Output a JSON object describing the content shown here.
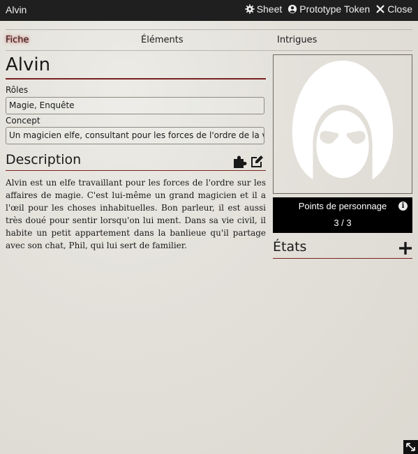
{
  "window": {
    "title": "Alvin",
    "controls": {
      "sheet_label": "Sheet",
      "prototype_label": "Prototype Token",
      "close_label": "Close"
    }
  },
  "tabs": [
    {
      "label": "Fiche",
      "active": true
    },
    {
      "label": "Éléments",
      "active": false
    },
    {
      "label": "Intrigues",
      "active": false
    }
  ],
  "character": {
    "name": "Alvin",
    "roles_label": "Rôles",
    "roles_value": "Magie, Enquête",
    "concept_label": "Concept",
    "concept_value": "Un magicien elfe, consultant pour les forces de l'ordre de la ville"
  },
  "description": {
    "heading": "Description",
    "text": "Alvin est un elfe travaillant pour les forces de l'ordre sur les affaires de magie. C'est lui-même un grand magicien et il a l'œil pour les choses inhabituelles. Bon parleur, il est aussi très doué pour sentir lorsqu'on lui ment. Dans sa vie civil, il habite un petit appartement dans la banlieue qu'il partage avec son chat, Phil, qui lui sert de familier."
  },
  "points": {
    "title": "Points de personnage",
    "value": "3 / 3"
  },
  "states": {
    "heading": "États"
  },
  "colors": {
    "accent_rule": "#7a1f1f",
    "titlebar": "#1f1f1f",
    "points_bg": "#000000",
    "parchment": "#e3e1da"
  },
  "icons": [
    "cog-icon",
    "user-circle-icon",
    "close-icon",
    "puzzle-icon",
    "edit-icon",
    "plus-icon",
    "info-icon",
    "resize-icon",
    "hooded-figure-icon"
  ]
}
